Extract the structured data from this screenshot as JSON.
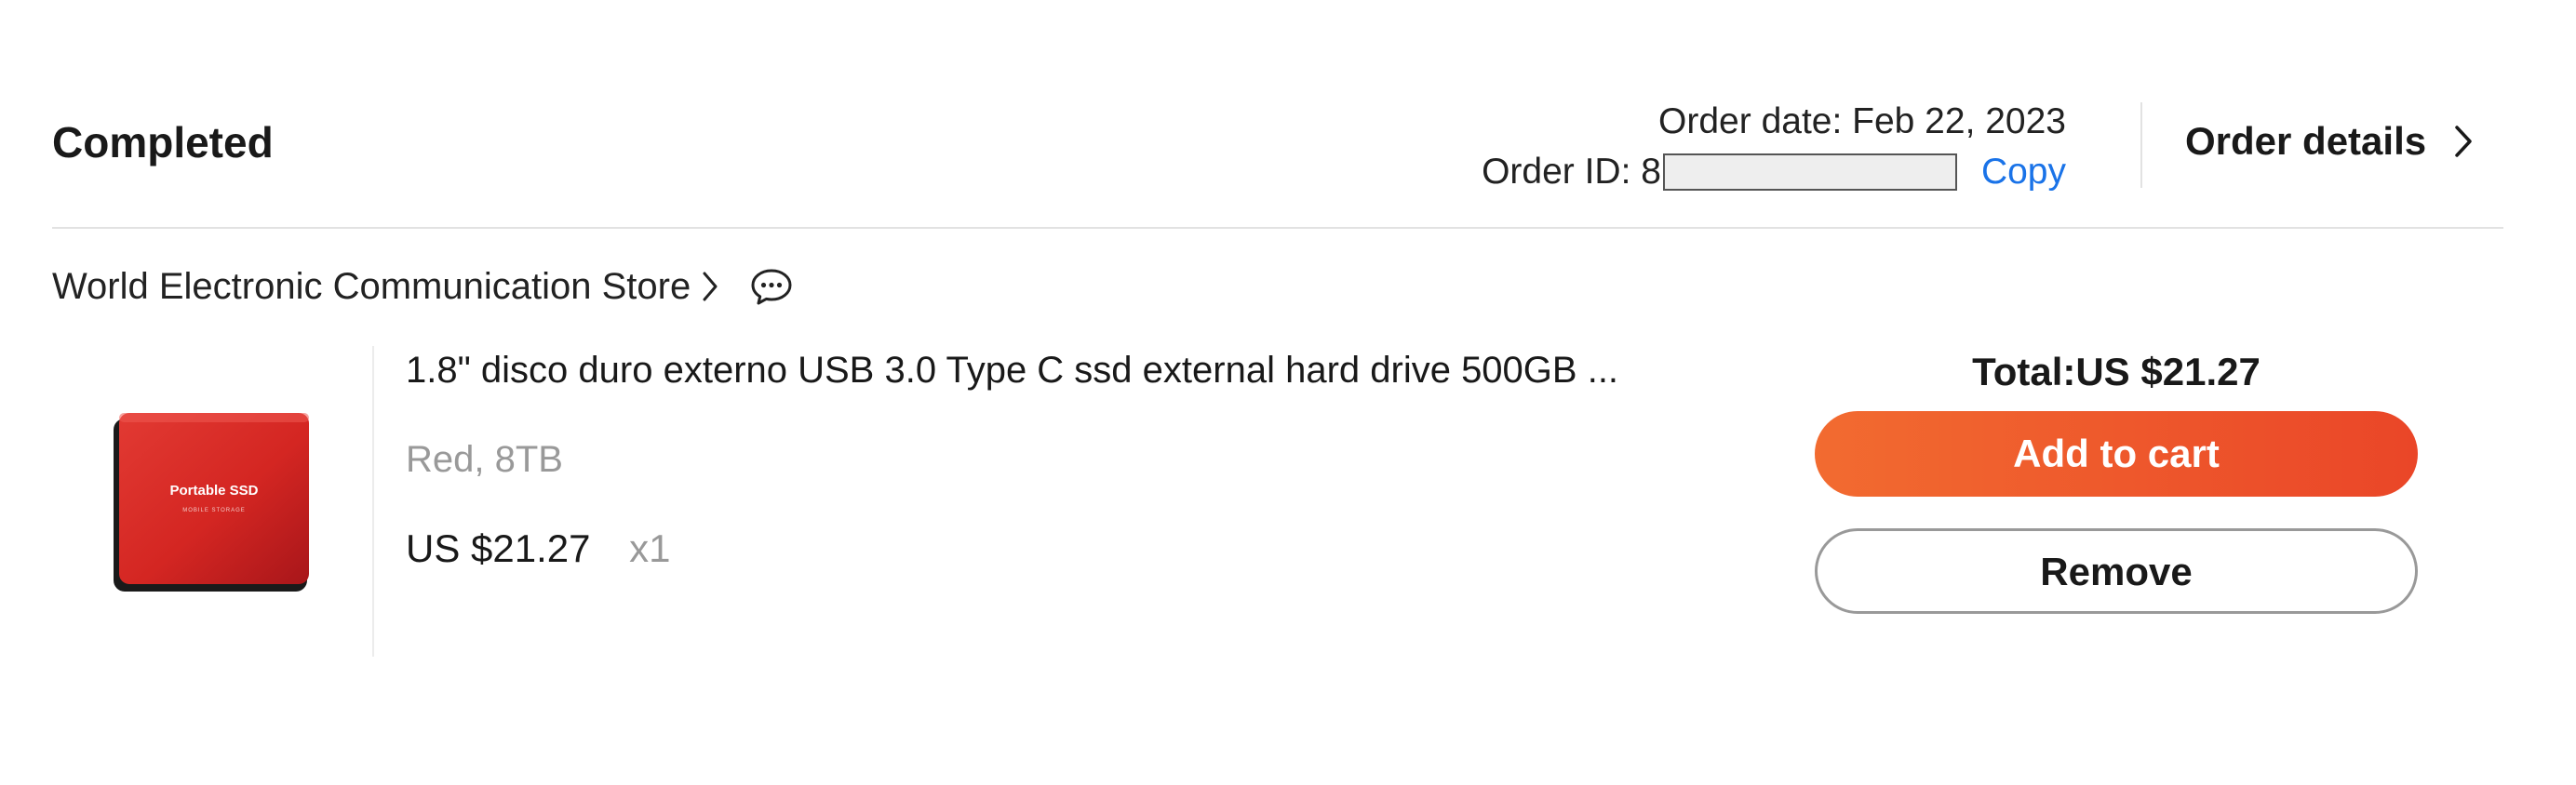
{
  "order": {
    "status": "Completed",
    "date_text": "Order date: Feb 22, 2023",
    "id_label": "Order ID: 8",
    "copy_label": "Copy",
    "details_label": "Order details"
  },
  "store": {
    "name": "World Electronic Communication Store"
  },
  "product": {
    "title": "1.8\" disco duro externo USB 3.0 Type C ssd external hard drive 500GB ...",
    "variant": "Red, 8TB",
    "price": "US $21.27",
    "quantity": "x1",
    "image_text": "Portable SSD",
    "image_subtext": "MOBILE STORAGE",
    "image_color": "#d42622"
  },
  "summary": {
    "total": "Total:US $21.27"
  },
  "actions": {
    "add_to_cart_label": "Add to cart",
    "remove_label": "Remove"
  },
  "colors": {
    "accent_start": "#f26b30",
    "accent_end": "#ea4628",
    "link": "#1a73e8"
  },
  "icons": {
    "details_chevron": "chevron-right-icon",
    "store_chevron": "chevron-right-icon",
    "chat": "chat-bubble-icon"
  }
}
